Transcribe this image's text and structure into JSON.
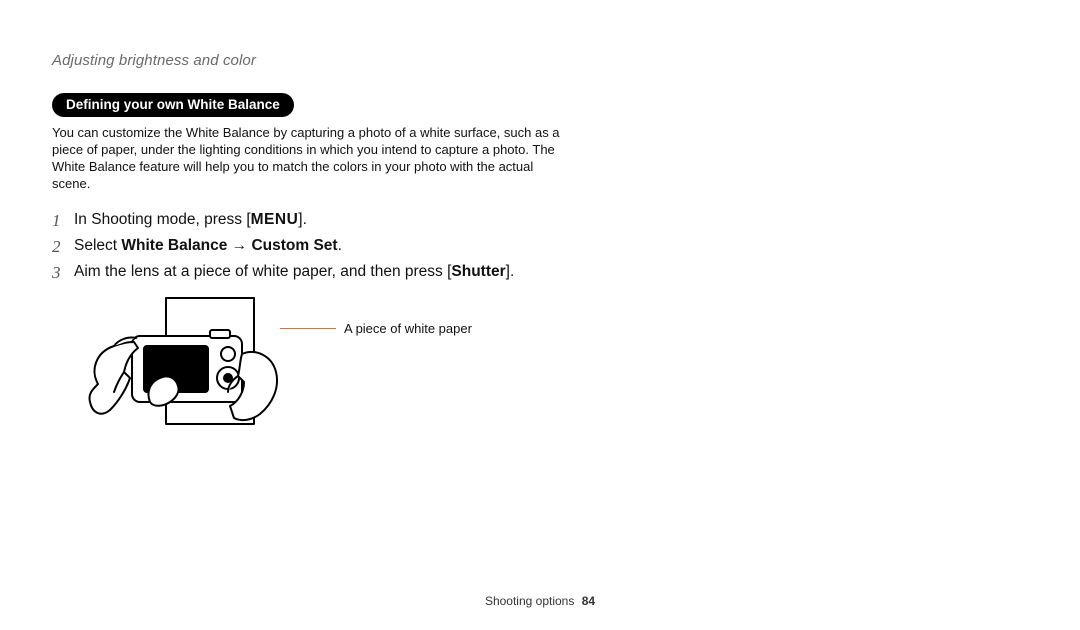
{
  "runningHead": "Adjusting brightness and color",
  "sectionPill": "Defining your own White Balance",
  "intro": "You can customize the White Balance by capturing a photo of a white surface, such as a piece of paper, under the lighting conditions in which you intend to capture a photo. The White Balance feature will help you to match the colors in your photo with the actual scene.",
  "steps": {
    "s1_a": "In Shooting mode, press [",
    "s1_menu": "MENU",
    "s1_b": "].",
    "s2_a": "Select ",
    "s2_b": "White Balance",
    "s2_arrow": " → ",
    "s2_c": "Custom Set",
    "s2_d": ".",
    "s3_a": "Aim the lens at a piece of white paper, and then press [",
    "s3_b": "Shutter",
    "s3_c": "]."
  },
  "callout": "A piece of white paper",
  "footer": {
    "section": "Shooting options",
    "page": "84"
  }
}
